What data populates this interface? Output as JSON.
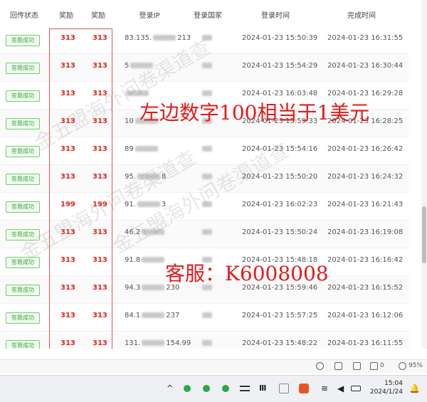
{
  "table": {
    "headers": [
      "回传状态",
      "奖励",
      "奖励",
      "登录IP",
      "登录国家",
      "登录时间",
      "完成时间"
    ],
    "rows": [
      {
        "status": "答题成功",
        "reward1": "313",
        "reward2": "313",
        "ip": "83.135.",
        "ip_tail": "213",
        "login": "2024-01-23 15:50:39",
        "done": "2024-01-23 16:31:55"
      },
      {
        "status": "答题成功",
        "reward1": "313",
        "reward2": "313",
        "ip": "5",
        "ip_tail": "",
        "login": "2024-01-23 15:54:29",
        "done": "2024-01-23 16:30:44"
      },
      {
        "status": "答题成功",
        "reward1": "313",
        "reward2": "313",
        "ip": "",
        "ip_tail": "",
        "login": "2024-01-23 16:03:48",
        "done": "2024-01-23 16:29:28"
      },
      {
        "status": "答题成功",
        "reward1": "313",
        "reward2": "313",
        "ip": "10",
        "ip_tail": "",
        "login": "2024-01-23 15:59:33",
        "done": "2024-01-23 16:28:25"
      },
      {
        "status": "答题成功",
        "reward1": "313",
        "reward2": "313",
        "ip": "89",
        "ip_tail": "",
        "login": "2024-01-23 15:54:16",
        "done": "2024-01-23 16:26:42"
      },
      {
        "status": "答题成功",
        "reward1": "313",
        "reward2": "313",
        "ip": "95.",
        "ip_tail": "8",
        "login": "2024-01-23 15:50:20",
        "done": "2024-01-23 16:24:32"
      },
      {
        "status": "答题成功",
        "reward1": "199",
        "reward2": "199",
        "ip": "91.",
        "ip_tail": "3",
        "login": "2024-01-23 16:02:23",
        "done": "2024-01-23 16:21:43"
      },
      {
        "status": "答题成功",
        "reward1": "313",
        "reward2": "313",
        "ip": "46.2",
        "ip_tail": "",
        "login": "2024-01-23 15:50:24",
        "done": "2024-01-23 16:19:08"
      },
      {
        "status": "答题成功",
        "reward1": "313",
        "reward2": "313",
        "ip": "91.8",
        "ip_tail": "",
        "login": "2024-01-23 15:48:18",
        "done": "2024-01-23 16:16:42"
      },
      {
        "status": "答题成功",
        "reward1": "313",
        "reward2": "313",
        "ip": "94.3",
        "ip_tail": "230",
        "login": "2024-01-23 15:59:46",
        "done": "2024-01-23 16:15:52"
      },
      {
        "status": "答题成功",
        "reward1": "313",
        "reward2": "313",
        "ip": "84.1",
        "ip_tail": "237",
        "login": "2024-01-23 15:57:25",
        "done": "2024-01-23 16:12:06"
      },
      {
        "status": "答题成功",
        "reward1": "313",
        "reward2": "313",
        "ip": "131.",
        "ip_tail": "154.99",
        "login": "2024-01-23 15:48:22",
        "done": "2024-01-23 16:11:55"
      }
    ]
  },
  "overlay": {
    "note": "左边数字100相当于1美元",
    "contact": "客服：K6008008"
  },
  "watermark": {
    "text1": "金五盟海外问卷渠道查",
    "text2": "金五盟海外问卷渠道查",
    "text3": "金五盟海外问卷渠道查"
  },
  "app_status": {
    "counter": "0",
    "zoom": "95%"
  },
  "taskbar": {
    "time": "15:04",
    "date": "2024/1/24"
  },
  "colors": {
    "reward_red": "#e0261d",
    "status_green": "#3aa53a",
    "overlay_red": "#e41a1a"
  }
}
